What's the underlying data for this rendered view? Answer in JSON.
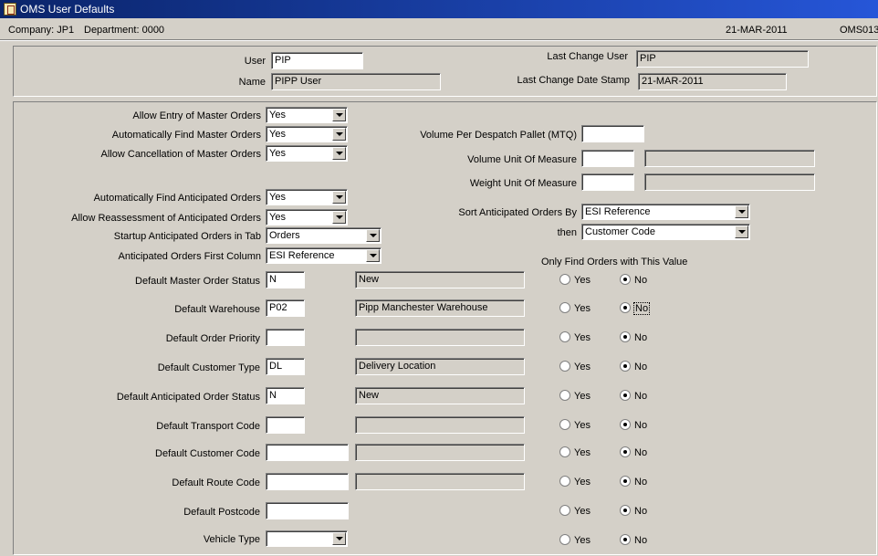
{
  "window": {
    "title": "OMS User Defaults"
  },
  "info": {
    "company": "Company:  JP1",
    "department": "Department:  0000",
    "date": "21-MAR-2011",
    "form_id": "OMS013"
  },
  "header": {
    "user_label": "User",
    "user_value": "PIP",
    "name_label": "Name",
    "name_value": "PIPP User",
    "last_change_user_label": "Last Change User",
    "last_change_user_value": "PIP",
    "last_change_date_label": "Last Change Date Stamp",
    "last_change_date_value": "21-MAR-2011"
  },
  "master": {
    "allow_entry_label": "Allow Entry of Master Orders",
    "allow_entry_value": "Yes",
    "auto_find_label": "Automatically Find Master Orders",
    "auto_find_value": "Yes",
    "allow_cancel_label": "Allow Cancellation of Master Orders",
    "allow_cancel_value": "Yes"
  },
  "anticipated": {
    "auto_find_label": "Automatically Find Anticipated Orders",
    "auto_find_value": "Yes",
    "reassess_label": "Allow Reassessment of Anticipated Orders",
    "reassess_value": "Yes",
    "startup_tab_label": "Startup Anticipated Orders in Tab",
    "startup_tab_value": "Orders",
    "first_column_label": "Anticipated Orders First Column",
    "first_column_value": "ESI Reference"
  },
  "measures": {
    "volume_pallet_label": "Volume Per Despatch Pallet (MTQ)",
    "volume_pallet_value": "",
    "volume_uom_label": "Volume Unit Of Measure",
    "volume_uom_value": "",
    "volume_uom_desc": "",
    "weight_uom_label": "Weight Unit Of Measure",
    "weight_uom_value": "",
    "weight_uom_desc": ""
  },
  "sort": {
    "sort_by_label": "Sort Anticipated Orders By",
    "sort_by_value": "ESI Reference",
    "then_label": "then",
    "then_value": "Customer Code"
  },
  "only_find_header": "Only Find Orders with This Value",
  "radio_yes": "Yes",
  "radio_no": "No",
  "defaults": [
    {
      "label": "Default Master Order Status",
      "code": "N",
      "desc": "New",
      "selected": "No"
    },
    {
      "label": "Default Warehouse",
      "code": "P02",
      "desc": "Pipp Manchester Warehouse",
      "selected": "No"
    },
    {
      "label": "Default Order Priority",
      "code": "",
      "desc": "",
      "selected": "No"
    },
    {
      "label": "Default Customer Type",
      "code": "DL",
      "desc": "Delivery Location",
      "selected": "No"
    },
    {
      "label": "Default Anticipated Order Status",
      "code": "N",
      "desc": "New",
      "selected": "No"
    },
    {
      "label": "Default Transport Code",
      "code": "",
      "desc": "",
      "selected": "No"
    },
    {
      "label": "Default Customer Code",
      "code": "",
      "desc": "",
      "selected": "No"
    },
    {
      "label": "Default Route Code",
      "code": "",
      "desc": "",
      "selected": "No"
    },
    {
      "label": "Default Postcode",
      "code": "",
      "selected": "No"
    },
    {
      "label": "Vehicle Type",
      "code": "",
      "selected": "No"
    }
  ],
  "colors": {
    "titlebar_start": "#0a246a",
    "titlebar_end": "#2656d8",
    "background": "#d4d0c8"
  }
}
